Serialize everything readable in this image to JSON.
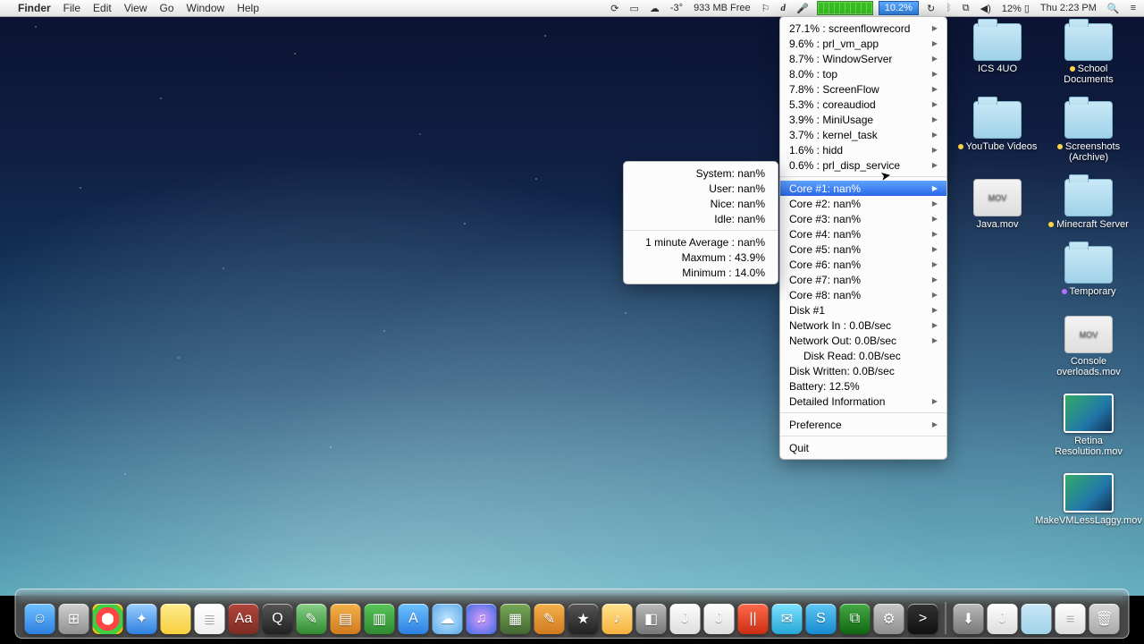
{
  "menubar": {
    "app": "Finder",
    "items": [
      "File",
      "Edit",
      "View",
      "Go",
      "Window",
      "Help"
    ],
    "extras": {
      "temp": "-3°",
      "mem": "933 MB Free",
      "d": "d",
      "cpu": "10.2%",
      "battery": "12%",
      "clock": "Thu 2:23 PM"
    }
  },
  "menu": {
    "procs": [
      "27.1% : screenflowrecord",
      "9.6% : prl_vm_app",
      "8.7% : WindowServer",
      "8.0% : top",
      "7.8% : ScreenFlow",
      "5.3% : coreaudiod",
      "3.9% : MiniUsage",
      "3.7% : kernel_task",
      "1.6% : hidd",
      "0.6% : prl_disp_service"
    ],
    "cores": [
      "Core #1: nan%",
      "Core #2: nan%",
      "Core #3: nan%",
      "Core #4: nan%",
      "Core #5: nan%",
      "Core #6: nan%",
      "Core #7: nan%",
      "Core #8: nan%"
    ],
    "disk": "Disk #1",
    "net_in": "Network In  : 0.0B/sec",
    "net_out": "Network Out: 0.0B/sec",
    "disk_read": "Disk Read: 0.0B/sec",
    "disk_written": "Disk Written: 0.0B/sec",
    "battery": "Battery: 12.5%",
    "detailed": "Detailed Information",
    "preference": "Preference",
    "quit": "Quit"
  },
  "submenu": {
    "system": "System: nan%",
    "user": "User: nan%",
    "nice": "Nice: nan%",
    "idle": "Idle: nan%",
    "avg": "1 minute Average : nan%",
    "max": "Maxmum  : 43.9%",
    "min": "Minimum : 14.0%"
  },
  "desktop": [
    {
      "t": "folder",
      "label": "ICS 4UO",
      "dot": ""
    },
    {
      "t": "folder",
      "label": "School Documents",
      "dot": "y"
    },
    {
      "t": "folder",
      "label": "YouTube Videos",
      "dot": "y"
    },
    {
      "t": "folder",
      "label": "Screenshots (Archive)",
      "dot": "y"
    },
    {
      "t": "mov",
      "label": "Java.mov",
      "dot": ""
    },
    {
      "t": "folder",
      "label": "Minecraft Server",
      "dot": "y"
    },
    {
      "t": "spacer",
      "label": ""
    },
    {
      "t": "folder",
      "label": "Temporary",
      "dot": "p"
    },
    {
      "t": "spacer",
      "label": ""
    },
    {
      "t": "mov",
      "label": "Console overloads.mov",
      "dot": ""
    },
    {
      "t": "spacer",
      "label": ""
    },
    {
      "t": "thumb",
      "label": "Retina Resolution.mov",
      "dot": ""
    },
    {
      "t": "spacer",
      "label": ""
    },
    {
      "t": "thumb",
      "label": "MakeVMLessLaggy.mov",
      "dot": ""
    }
  ],
  "dock": [
    {
      "n": "finder",
      "c": "linear-gradient(#6ec2ff,#2d7fe0)",
      "g": "☺"
    },
    {
      "n": "launchpad",
      "c": "linear-gradient(#d0d0d0,#909090)",
      "g": "⊞"
    },
    {
      "n": "chrome",
      "c": "radial-gradient(circle,#fff 28%,#f44 0 55%,#4c4 0 78%,#fb0 0)",
      "g": ""
    },
    {
      "n": "safari",
      "c": "linear-gradient(#9cd0ff,#2d7fe0)",
      "g": "✦"
    },
    {
      "n": "stickies",
      "c": "linear-gradient(#ffeb8e,#f6cf3e)",
      "g": ""
    },
    {
      "n": "reminders",
      "c": "linear-gradient(#fff,#eee)",
      "g": "≣"
    },
    {
      "n": "dictionary",
      "c": "linear-gradient(#b2453a,#7d2d24)",
      "g": "Aa"
    },
    {
      "n": "quicktime",
      "c": "linear-gradient(#555,#222)",
      "g": "Q"
    },
    {
      "n": "preview",
      "c": "linear-gradient(#8ad08a,#2f8a2f)",
      "g": "✎"
    },
    {
      "n": "keynote",
      "c": "linear-gradient(#f4b24a,#d0791f)",
      "g": "▤"
    },
    {
      "n": "numbers",
      "c": "linear-gradient(#59c659,#2f8a2f)",
      "g": "▥"
    },
    {
      "n": "appstore",
      "c": "linear-gradient(#6ec2ff,#2d7fe0)",
      "g": "A"
    },
    {
      "n": "icloud",
      "c": "radial-gradient(circle,#bfe5ff,#58a8e8)",
      "g": "☁"
    },
    {
      "n": "itunes",
      "c": "radial-gradient(circle,#d89bff,#3b6ae0)",
      "g": "♫"
    },
    {
      "n": "minecraft",
      "c": "linear-gradient(#7a5,#463)",
      "g": "▦"
    },
    {
      "n": "pages",
      "c": "linear-gradient(#f4b24a,#d0791f)",
      "g": "✎"
    },
    {
      "n": "imovie",
      "c": "linear-gradient(#555,#222)",
      "g": "★"
    },
    {
      "n": "app-a",
      "c": "linear-gradient(#ffe38e,#f6b23e)",
      "g": "♪"
    },
    {
      "n": "app-b",
      "c": "linear-gradient(#bbb,#777)",
      "g": "◧"
    },
    {
      "n": "app-j1",
      "c": "linear-gradient(#fff,#ddd)",
      "g": "J"
    },
    {
      "n": "app-j2",
      "c": "linear-gradient(#fff,#ddd)",
      "g": "J"
    },
    {
      "n": "parallels",
      "c": "linear-gradient(#ff6a4d,#cc2d12)",
      "g": "||"
    },
    {
      "n": "messages",
      "c": "linear-gradient(#7be3ff,#29a6d6)",
      "g": "✉"
    },
    {
      "n": "skype",
      "c": "linear-gradient(#5ec7f4,#178bd0)",
      "g": "S"
    },
    {
      "n": "activity",
      "c": "linear-gradient(#4a4,#161)",
      "g": "⧉"
    },
    {
      "n": "sysprefs",
      "c": "linear-gradient(#c8c8c8,#8e8e8e)",
      "g": "⚙"
    },
    {
      "n": "terminal",
      "c": "linear-gradient(#333,#111)",
      "g": ">"
    },
    {
      "n": "sep",
      "c": "",
      "g": ""
    },
    {
      "n": "downloads",
      "c": "linear-gradient(#bbb,#777)",
      "g": "⬇"
    },
    {
      "n": "app-j3",
      "c": "linear-gradient(#fff,#ddd)",
      "g": "J"
    },
    {
      "n": "folder",
      "c": "linear-gradient(#c9e8f6,#9fd2e8)",
      "g": ""
    },
    {
      "n": "doc",
      "c": "linear-gradient(#fff,#ddd)",
      "g": "≡"
    },
    {
      "n": "trash",
      "c": "linear-gradient(#d7d7d7,#a8a8a8)",
      "g": "🗑"
    }
  ]
}
